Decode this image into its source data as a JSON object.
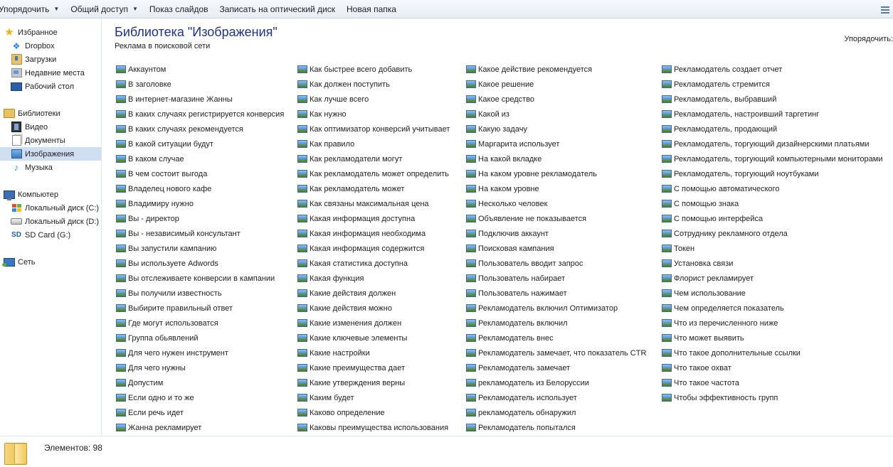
{
  "toolbar": {
    "organize": "Упорядочить",
    "share": "Общий доступ",
    "slideshow": "Показ слайдов",
    "burn": "Записать на оптический диск",
    "new_folder": "Новая папка"
  },
  "sidebar": {
    "favorites": {
      "label": "Избранное",
      "items": [
        "Dropbox",
        "Загрузки",
        "Недавние места",
        "Рабочий стол"
      ]
    },
    "libraries": {
      "label": "Библиотеки",
      "items": [
        "Видео",
        "Документы",
        "Изображения",
        "Музыка"
      ],
      "selected": "Изображения"
    },
    "computer": {
      "label": "Компьютер",
      "items": [
        "Локальный диск (C:)",
        "Локальный диск (D:)",
        "SD Card (G:)"
      ]
    },
    "network": {
      "label": "Сеть"
    }
  },
  "main": {
    "title": "Библиотека \"Изображения\"",
    "subtitle": "Реклама в поисковой сети",
    "arrange_label": "Упорядочить:"
  },
  "files": {
    "col1": [
      "Аккаунтом",
      "В заголовке",
      "В интернет-магазине Жанны",
      "В каких случаях регистрируется конверсия",
      "В каких случаях рекомендуется",
      "В какой ситуации будут",
      "В каком случае",
      "В чем состоит выгода",
      "Владелец нового кафе",
      "Владимиру нужно",
      "Вы - директор",
      "Вы - независимый консультант",
      "Вы запустили кампанию",
      "Вы используете Adwords",
      "Вы отслеживаете конверсии в кампании",
      "Вы получили известность",
      "Выбирите правильный ответ",
      "Где могут использоватся",
      "Группа обьявлений",
      "Для чего нужен инструмент",
      "Для чего нужны",
      "Допустим",
      "Если одно и то же",
      "Если речь идет",
      "Жанна рекламирует"
    ],
    "col2": [
      "Как быстрее всего добавить",
      "Как должен поступить",
      "Как лучше всего",
      "Как нужно",
      "Как оптимизатор конверсий учитывает",
      "Как правило",
      "Как рекламодатели могут",
      "Как рекламодатель может определить",
      "Как рекламодатель может",
      "Как связаны максимальная цена",
      "Какая информация доступна",
      "Какая информация необходима",
      "Какая информация содержится",
      "Какая статистика доступна",
      "Какая функция",
      "Какие действия должен",
      "Какие действия можно",
      "Какие изменения должен",
      "Какие ключевые элементы",
      "Какие настройки",
      "Какие преимущества дает",
      "Какие утверждения верны",
      "Каким будет",
      "Каково определение",
      "Каковы преимущества использования"
    ],
    "col3": [
      "Какое действие рекомендуется",
      "Какое решение",
      "Какое средство",
      "Какой из",
      "Какую задачу",
      "Маргарита использует",
      "На какой вкладке",
      "На каком уровне рекламодатель",
      "На каком уровне",
      "Несколько человек",
      "Объявление не показывается",
      "Подключив аккаунт",
      "Поисковая кампания",
      "Пользователь вводит запрос",
      "Пользователь набирает",
      "Пользователь нажимает",
      "Рекламодатель включил Оптимизатор",
      "Рекламодатель включил",
      "Рекламодатель внес",
      "Рекламодатель замечает, что показатель CTR",
      "Рекламодатель замечает",
      "рекламодатель из Белоруссии",
      "Рекламодатель использует",
      "рекламодатель обнаружил",
      "Рекламодатель попытался"
    ],
    "col4": [
      "Рекламодатель создает отчет",
      "Рекламодатель стремится",
      "Рекламодатель, выбравший",
      "Рекламодатель, настроивший таргетинг",
      "Рекламодатель, продающий",
      "Рекламодатель, торгующий дизайнерскими платьями",
      "Рекламодатель, торгующий компьютерными мониторами",
      "Рекламодатель, торгующий ноутбуками",
      "С помощью автоматического",
      "С помощью знака",
      "С помощью интерфейса",
      "Сотруднику рекламного отдела",
      "Токен",
      "Установка связи",
      "Флорист рекламирует",
      "Чем использование",
      "Чем определяется показатель",
      "Что из перечисленного ниже",
      "Что может выявить",
      "Что такое дополнительные ссылки",
      "Что такое охват",
      "Что такое частота",
      "Чтобы эффективность групп"
    ]
  },
  "status": {
    "text": "Элементов: 98"
  }
}
